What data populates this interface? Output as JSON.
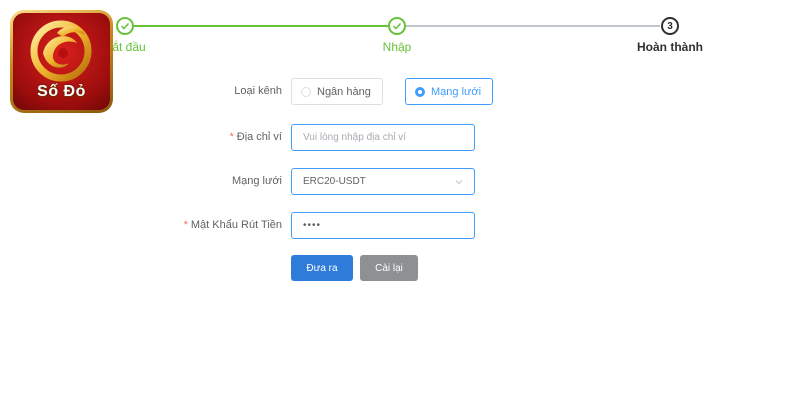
{
  "steps": [
    {
      "label": "Bắt đầu",
      "status": "done"
    },
    {
      "label": "Nhập",
      "status": "done"
    },
    {
      "label": "Hoàn thành",
      "number": "3",
      "status": "current"
    }
  ],
  "logo": {
    "text": "Số Đỏ"
  },
  "form": {
    "channel_type": {
      "label": "Loại kênh",
      "options": [
        "Ngân hàng",
        "Mạng lưới"
      ],
      "selected": "Mạng lưới"
    },
    "wallet_address": {
      "label": "Địa chỉ ví",
      "required_mark": "*",
      "value": "",
      "placeholder": "Vui lòng nhập địa chỉ ví"
    },
    "network": {
      "label": "Mạng lưới",
      "value": "ERC20-USDT"
    },
    "withdraw_password": {
      "label": "Mật Khẩu Rút Tiền",
      "required_mark": "*",
      "value": "••••"
    },
    "buttons": {
      "submit": "Đưa ra",
      "reset": "Cài lại"
    }
  },
  "colors": {
    "done": "#67c23a",
    "accent": "#409eff",
    "submit": "#2f7bd9",
    "reset": "#8e9093",
    "required": "#f56c6c"
  }
}
